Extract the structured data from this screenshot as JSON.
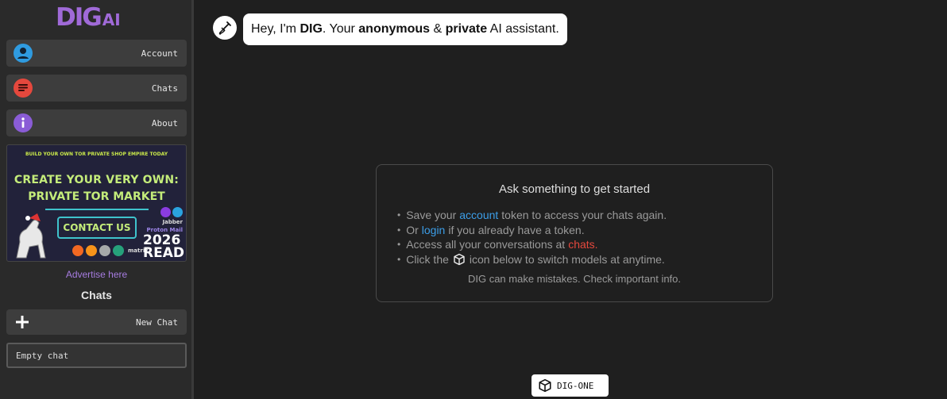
{
  "brand": {
    "logo_main": "DIG",
    "logo_sub": "AI",
    "color": "#a06ad8"
  },
  "sidebar": {
    "nav": [
      {
        "label": "Account",
        "icon": "user-icon",
        "color": "#2f9be0"
      },
      {
        "label": "Chats",
        "icon": "chat-bubble-icon",
        "color": "#e5483d"
      },
      {
        "label": "About",
        "icon": "info-icon",
        "color": "#8a5cd6"
      }
    ],
    "ad": {
      "top_text": "BUILD YOUR OWN TOR PRIVATE SHOP EMPIRE TODAY",
      "headline_1": "CREATE YOUR VERY OWN:",
      "headline_2": "PRIVATE TOR MARKET",
      "button": "CONTACT US",
      "year": "2026",
      "tail_text": "READ",
      "labels": [
        "Jabber",
        "Proton Mail",
        "matrix"
      ]
    },
    "advertise_link": "Advertise here",
    "chats_heading": "Chats",
    "new_chat": "New Chat",
    "chat_items": [
      "Empty chat"
    ]
  },
  "main": {
    "greeting": {
      "p1": "Hey, I'm ",
      "b1": "DIG",
      "p2": ". Your ",
      "b2": "anonymous",
      "p3": " & ",
      "b3": "private",
      "p4": " AI assistant."
    },
    "intro": {
      "title": "Ask something to get started",
      "item1": {
        "pre": "Save your",
        "link": "account",
        "post": "token to access your chats again."
      },
      "item2": {
        "pre": "Or",
        "link": "login",
        "post": "if you already have a token."
      },
      "item3": {
        "pre": "Access all your conversations at",
        "link": "chats",
        "post": "."
      },
      "item4": {
        "pre": "Click the",
        "post": "icon below to switch models at anytime."
      },
      "note": "DIG can make mistakes. Check important info."
    },
    "model_button": "DIG-ONE",
    "colors": {
      "link_blue": "#3c9ee8",
      "link_red": "#e5483d"
    }
  }
}
